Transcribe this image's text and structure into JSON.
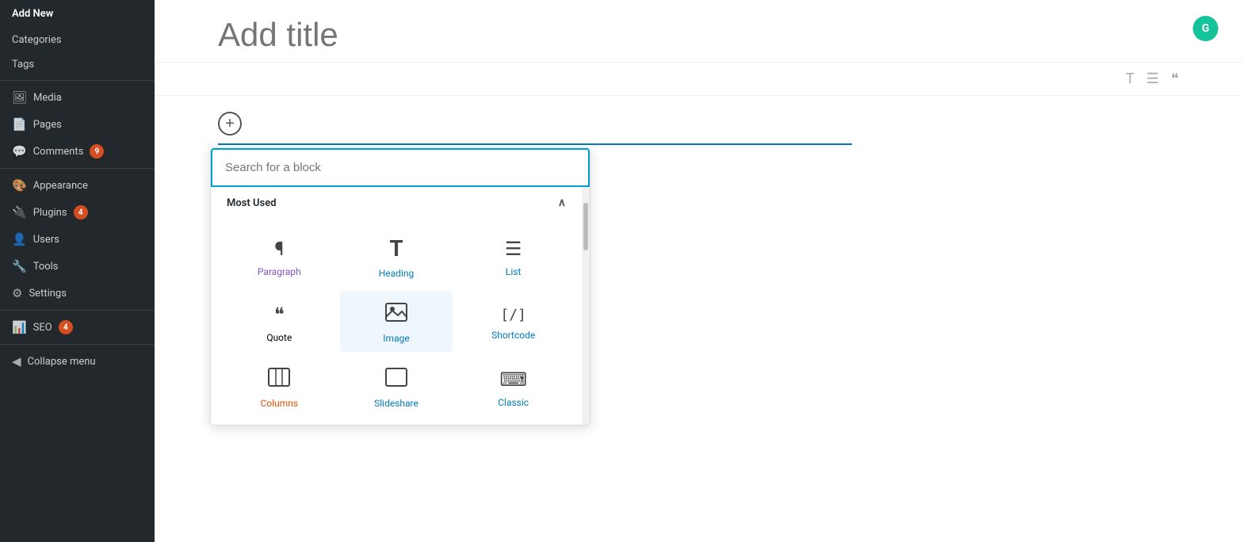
{
  "sidebar": {
    "top_item": "Add New",
    "items": [
      {
        "id": "categories",
        "label": "Categories",
        "icon": "",
        "badge": null
      },
      {
        "id": "tags",
        "label": "Tags",
        "icon": "",
        "badge": null
      },
      {
        "id": "media",
        "label": "Media",
        "icon": "🖼",
        "badge": null
      },
      {
        "id": "pages",
        "label": "Pages",
        "icon": "📄",
        "badge": null
      },
      {
        "id": "comments",
        "label": "Comments",
        "icon": "💬",
        "badge": "9"
      },
      {
        "id": "appearance",
        "label": "Appearance",
        "icon": "🎨",
        "badge": null
      },
      {
        "id": "plugins",
        "label": "Plugins",
        "icon": "🔌",
        "badge": "4"
      },
      {
        "id": "users",
        "label": "Users",
        "icon": "👤",
        "badge": null
      },
      {
        "id": "tools",
        "label": "Tools",
        "icon": "🔧",
        "badge": null
      },
      {
        "id": "settings",
        "label": "Settings",
        "icon": "⚙",
        "badge": null
      },
      {
        "id": "seo",
        "label": "SEO",
        "icon": "📊",
        "badge": "4"
      },
      {
        "id": "collapse",
        "label": "Collapse menu",
        "icon": "◀",
        "badge": null
      }
    ]
  },
  "editor": {
    "title_placeholder": "Add title",
    "grammarly_letter": "G"
  },
  "toolbar": {
    "icons": [
      "T",
      "≡",
      "❝"
    ]
  },
  "block_picker": {
    "search_placeholder": "Search for a block",
    "section_label": "Most Used",
    "blocks": [
      {
        "id": "paragraph",
        "icon": "¶",
        "label": "Paragraph",
        "color": "purple"
      },
      {
        "id": "heading",
        "icon": "T",
        "label": "Heading",
        "color": "blue"
      },
      {
        "id": "list",
        "icon": "≡",
        "label": "List",
        "color": "blue"
      },
      {
        "id": "quote",
        "icon": "❝",
        "label": "Quote",
        "color": "default"
      },
      {
        "id": "image",
        "icon": "🖼",
        "label": "Image",
        "color": "blue"
      },
      {
        "id": "shortcode",
        "icon": "[/]",
        "label": "Shortcode",
        "color": "blue"
      },
      {
        "id": "columns",
        "icon": "⊞",
        "label": "Columns",
        "color": "orange"
      },
      {
        "id": "slideshare",
        "icon": "▭",
        "label": "Slideshare",
        "color": "blue"
      },
      {
        "id": "classic",
        "icon": "⌨",
        "label": "Classic",
        "color": "blue"
      }
    ]
  }
}
